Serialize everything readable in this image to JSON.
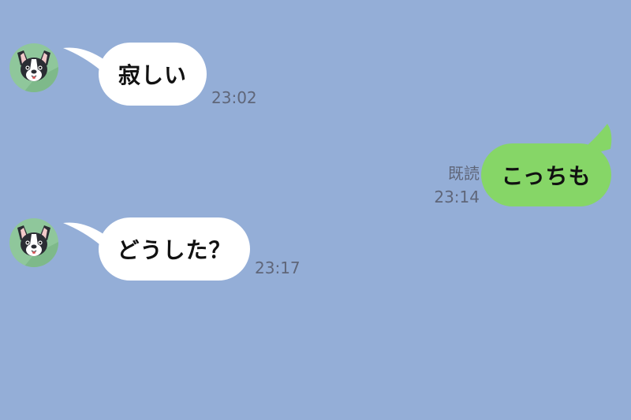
{
  "messages": [
    {
      "direction": "incoming",
      "text": "寂しい",
      "time": "23:02",
      "avatar_icon": "dog-avatar-icon"
    },
    {
      "direction": "outgoing",
      "text": "こっちも",
      "read": "既読",
      "time": "23:14"
    },
    {
      "direction": "incoming",
      "text": "どうした？",
      "time": "23:17",
      "avatar_icon": "dog-avatar-icon"
    }
  ],
  "colors": {
    "background": "#94aed7",
    "incoming_bubble": "#ffffff",
    "outgoing_bubble": "#86d667",
    "meta_text": "#5f6679",
    "avatar_bg": "#8fc79b"
  }
}
